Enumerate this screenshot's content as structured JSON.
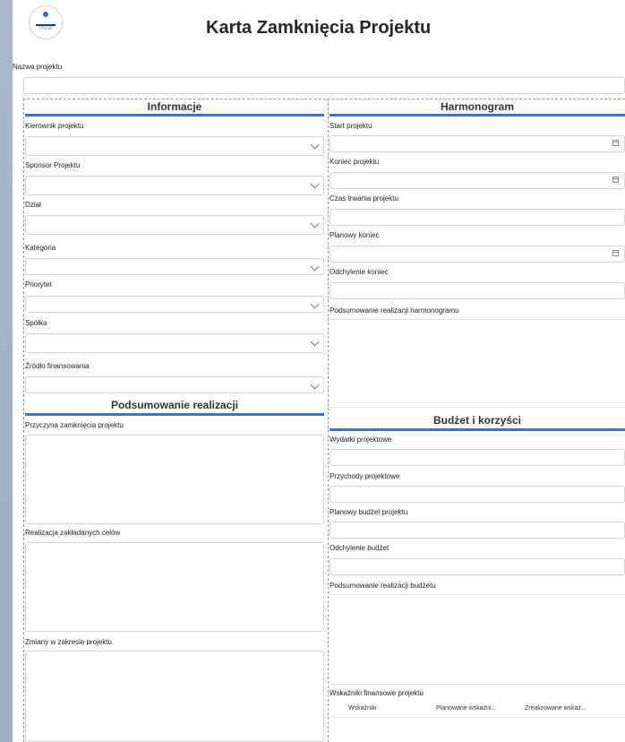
{
  "title": "Karta Zamknięcia Projektu",
  "logo": {
    "text": "VIVUS"
  },
  "project_name": {
    "label": "Nazwa projektu",
    "value": ""
  },
  "info": {
    "header": "Informacje",
    "fields": [
      {
        "label": "Kierownik projektu",
        "value": ""
      },
      {
        "label": "Sponsor Projektu",
        "value": ""
      },
      {
        "label": "Dział",
        "value": ""
      },
      {
        "label": "Kategoria",
        "value": ""
      },
      {
        "label": "Priorytet",
        "value": ""
      },
      {
        "label": "Spółka",
        "value": ""
      },
      {
        "label": "Źródło finansowania",
        "value": ""
      }
    ]
  },
  "schedule": {
    "header": "Harmonogram",
    "fields": [
      {
        "label": "Start projektu",
        "value": ""
      },
      {
        "label": "Koniec projektu",
        "value": ""
      },
      {
        "label": "Czas trwania projektu",
        "value": ""
      },
      {
        "label": "Planowy koniec",
        "value": ""
      },
      {
        "label": "Odchylenie koniec",
        "value": ""
      },
      {
        "label": "Podsumowanie realizacji harmonogramu",
        "value": ""
      }
    ]
  },
  "summary": {
    "header": "Podsumowanie realizacji",
    "fields": [
      {
        "label": "Przyczyna zamknięcia projektu",
        "value": ""
      },
      {
        "label": "Realizacja zakładanych celów",
        "value": ""
      },
      {
        "label": "Zmiany w zakresie projektu",
        "value": ""
      }
    ]
  },
  "budget": {
    "header": "Budżet i korzyści",
    "fields": [
      {
        "label": "Wydatki projektowe",
        "value": ""
      },
      {
        "label": "Przychody projektowe",
        "value": ""
      },
      {
        "label": "Planowy budżet projektu",
        "value": ""
      },
      {
        "label": "Odchylenie budżet",
        "value": ""
      },
      {
        "label": "Podsumowanie realizacji budżetu",
        "value": ""
      }
    ],
    "indicators": {
      "label": "Wskaźniki finansowe projektu",
      "columns": [
        "Wskaźniki",
        "Planowane wskaźni...",
        "Zrealizowane wskaź..."
      ]
    }
  },
  "colors": {
    "accent": "#3e6fd0",
    "border": "#d4d4d4"
  }
}
